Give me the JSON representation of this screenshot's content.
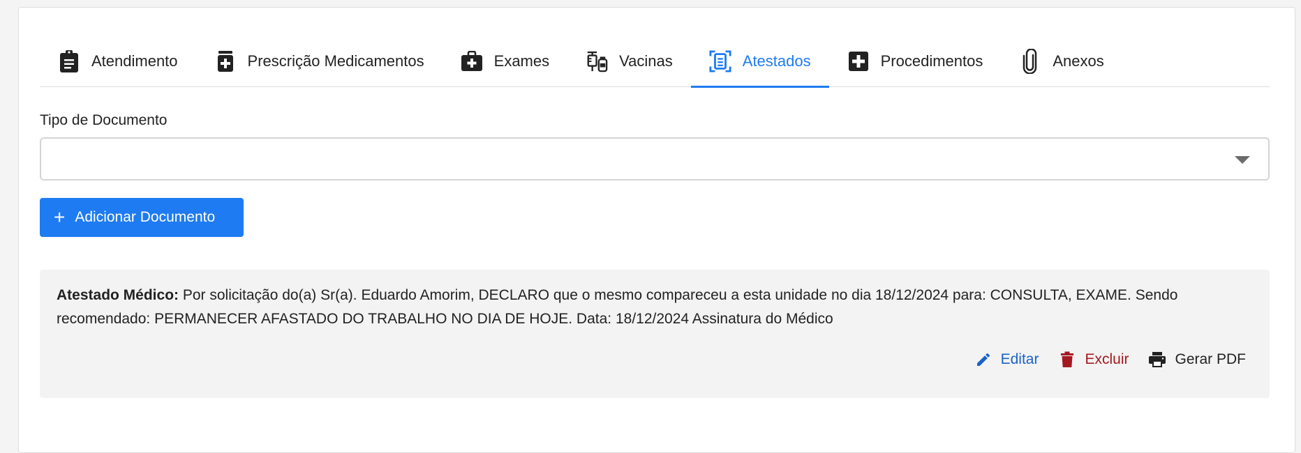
{
  "tabs": [
    {
      "label": "Atendimento",
      "icon": "clipboard-icon",
      "active": false
    },
    {
      "label": "Prescrição Medicamentos",
      "icon": "medication-icon",
      "active": false
    },
    {
      "label": "Exames",
      "icon": "medical-kit-icon",
      "active": false
    },
    {
      "label": "Vacinas",
      "icon": "vaccine-icon",
      "active": false
    },
    {
      "label": "Atestados",
      "icon": "document-scan-icon",
      "active": true
    },
    {
      "label": "Procedimentos",
      "icon": "plus-square-icon",
      "active": false
    },
    {
      "label": "Anexos",
      "icon": "paperclip-icon",
      "active": false
    }
  ],
  "form": {
    "document_type_label": "Tipo de Documento",
    "document_type_value": "",
    "add_button_label": "Adicionar Documento"
  },
  "document": {
    "title": "Atestado Médico:",
    "body": " Por solicitação do(a) Sr(a). Eduardo Amorim, DECLARO que o mesmo compareceu a esta unidade no dia 18/12/2024 para: CONSULTA, EXAME. Sendo recomendado: PERMANECER AFASTADO DO TRABALHO NO DIA DE HOJE. Data: 18/12/2024 Assinatura do Médico",
    "actions": {
      "edit_label": "Editar",
      "delete_label": "Excluir",
      "pdf_label": "Gerar PDF"
    }
  },
  "colors": {
    "accent": "#1e7bf2",
    "edit": "#1a62c9",
    "delete": "#a51820",
    "doc_background": "#f3f3f3"
  }
}
